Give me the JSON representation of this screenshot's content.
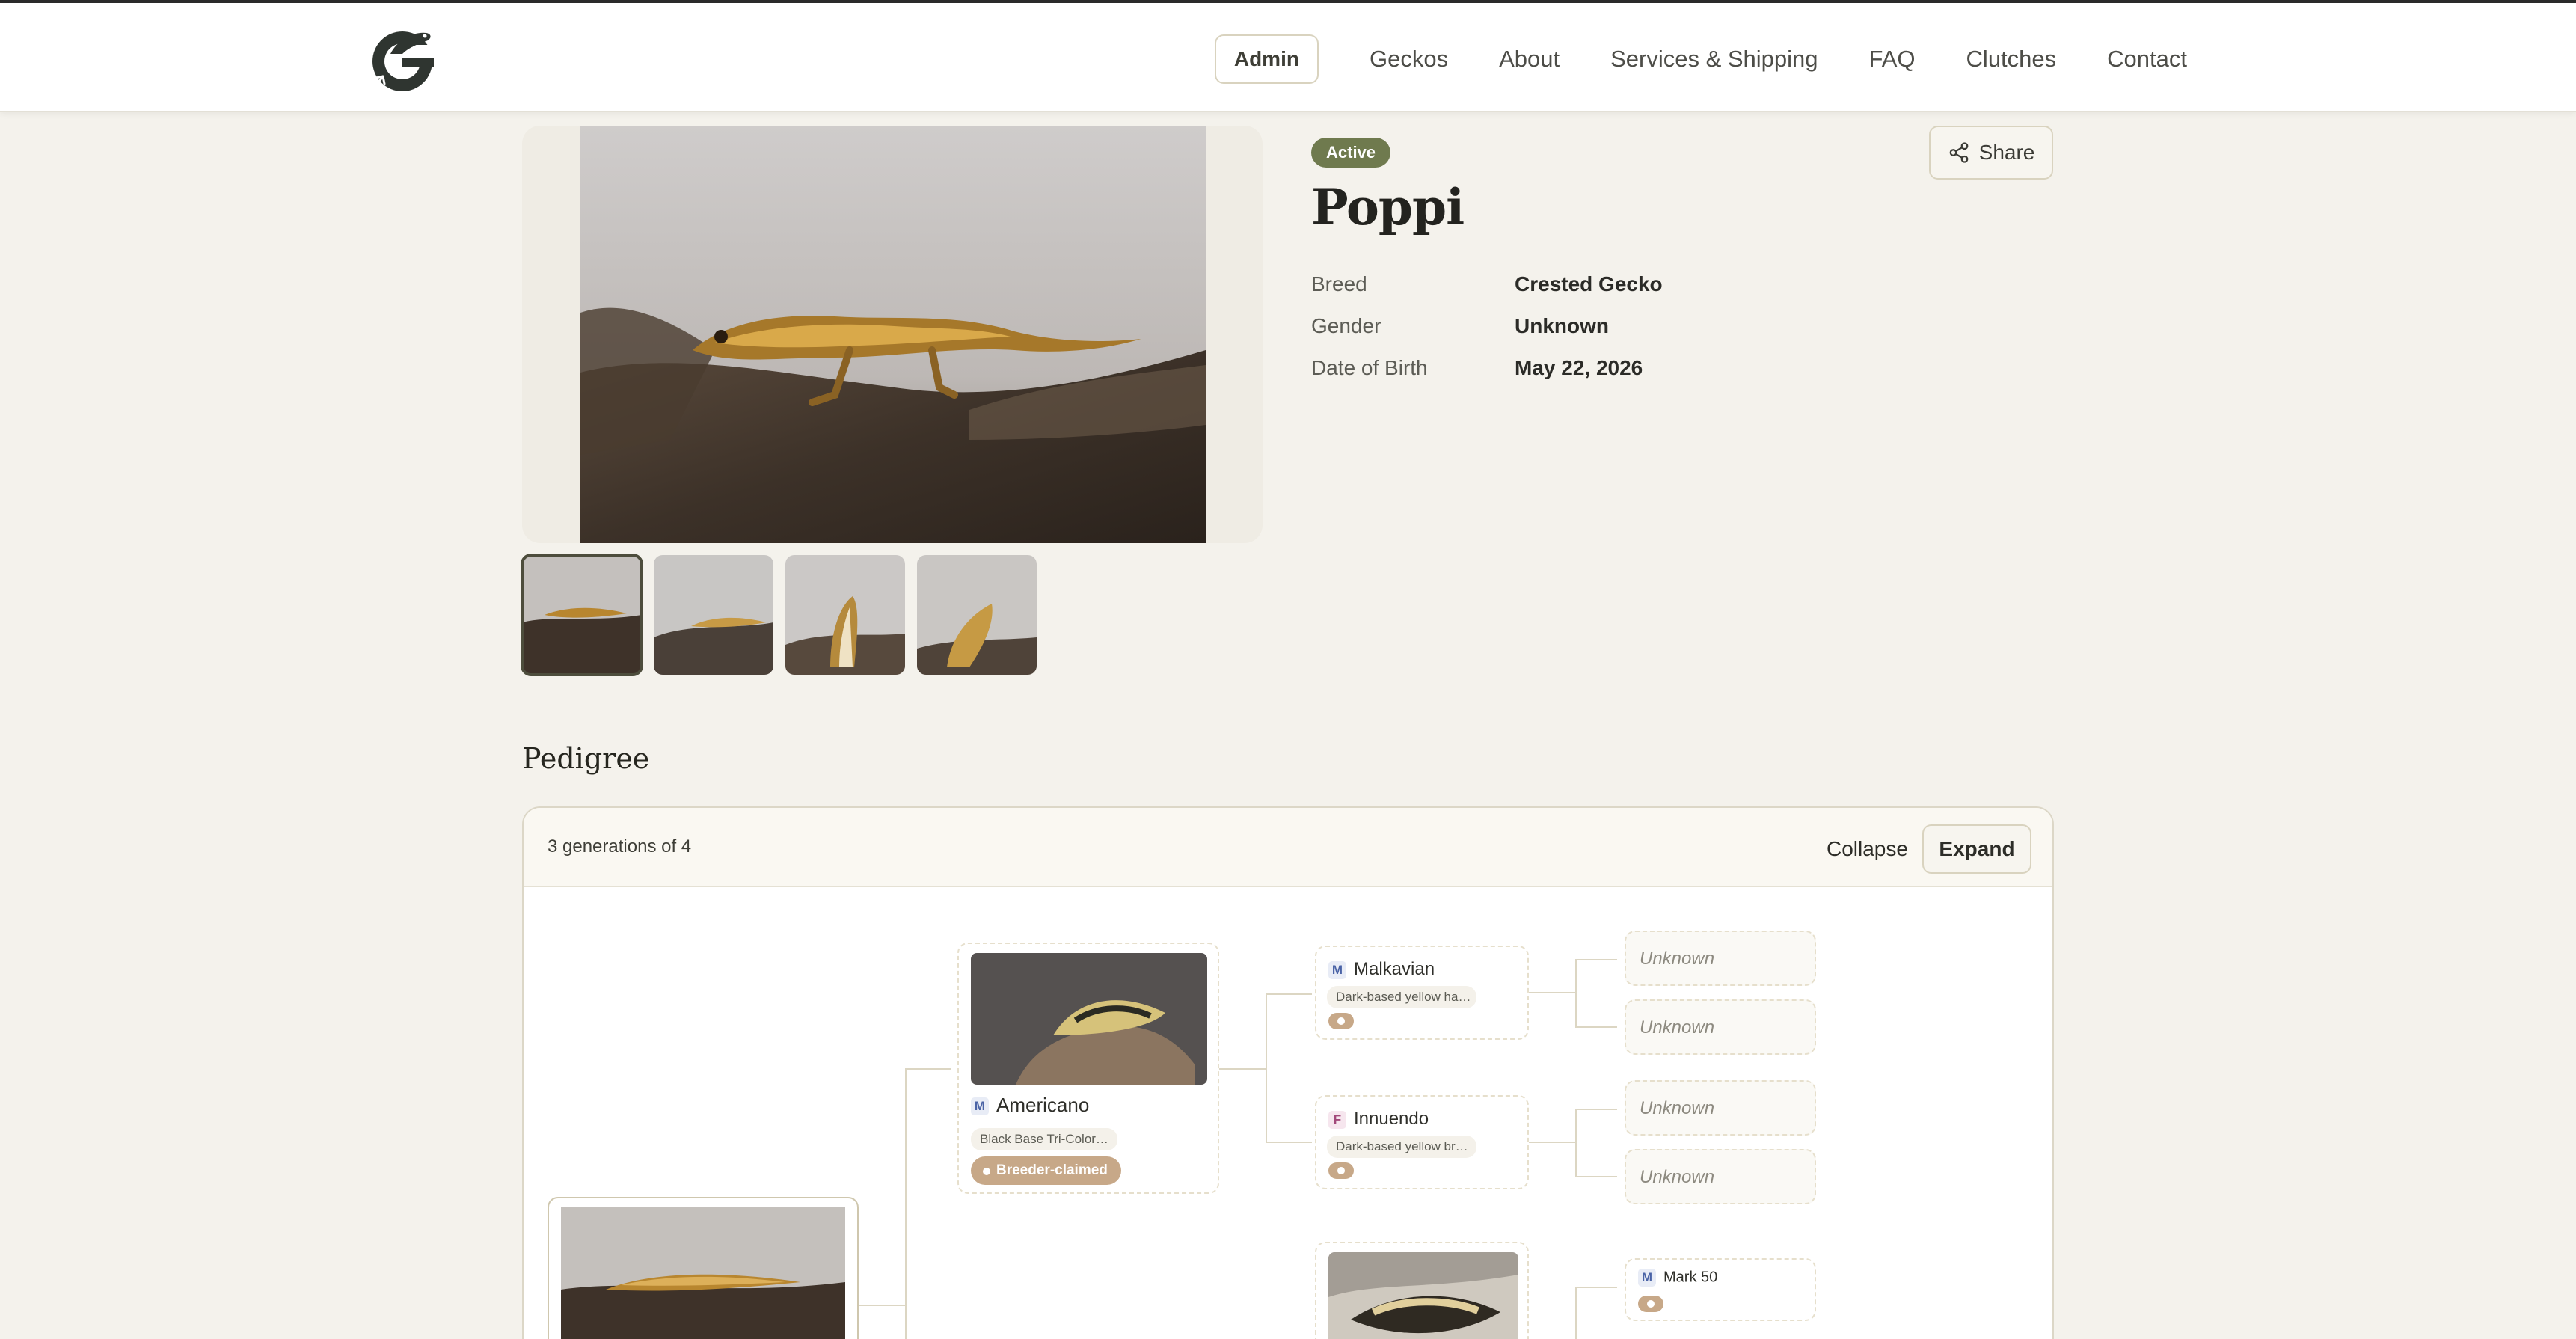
{
  "nav": {
    "admin": "Admin",
    "items": [
      "Geckos",
      "About",
      "Services & Shipping",
      "FAQ",
      "Clutches",
      "Contact"
    ]
  },
  "gecko": {
    "status": "Active",
    "name": "Poppi",
    "share_label": "Share",
    "details": [
      {
        "label": "Breed",
        "value": "Crested Gecko"
      },
      {
        "label": "Gender",
        "value": "Unknown"
      },
      {
        "label": "Date of Birth",
        "value": "May 22, 2026"
      }
    ]
  },
  "pedigree": {
    "title": "Pedigree",
    "generations_text": "3 generations of 4",
    "collapse_label": "Collapse",
    "expand_label": "Expand",
    "sire": {
      "sex": "M",
      "name": "Americano",
      "morph": "Black Base Tri-Color…",
      "claim": "Breeder-claimed"
    },
    "sire_sire": {
      "sex": "M",
      "name": "Malkavian",
      "morph": "Dark-based yellow ha…"
    },
    "sire_dam": {
      "sex": "F",
      "name": "Innuendo",
      "morph": "Dark-based yellow br…"
    },
    "unknown_label": "Unknown",
    "dam_sire": {
      "sex": "M",
      "name": "Mark 50"
    }
  },
  "colors": {
    "accent": "#6f7a4e",
    "claim": "#c7a888",
    "background": "#f4f2ec"
  }
}
